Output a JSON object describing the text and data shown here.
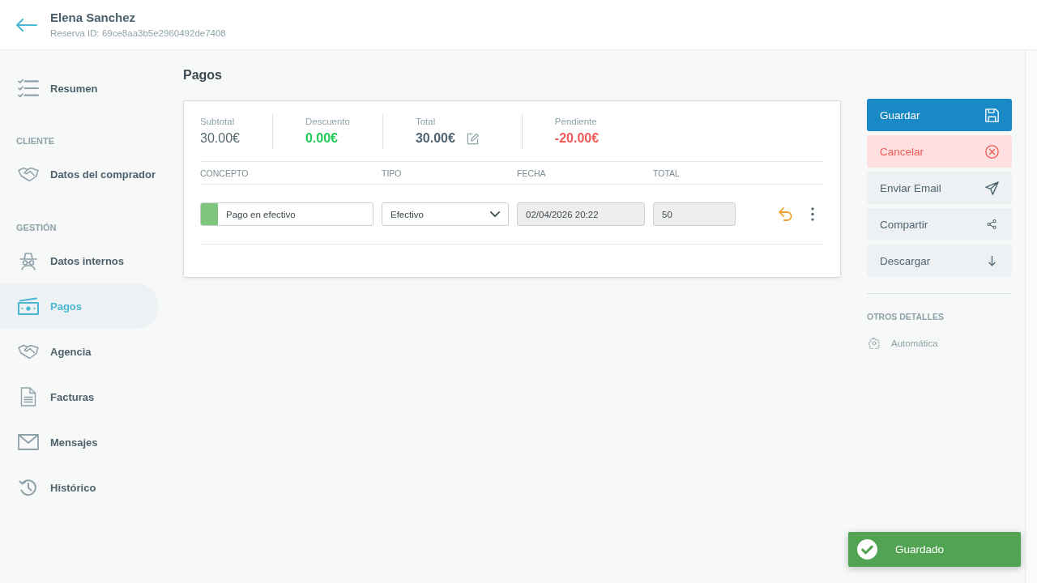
{
  "header": {
    "title": "Elena Sanchez",
    "subtitle": "Reserva ID: 69ce8aa3b5e2960492de7408"
  },
  "sidebar": {
    "groups": [
      {
        "items": [
          {
            "label": "Resumen",
            "selected": false
          }
        ]
      },
      {
        "heading": "CLIENTE",
        "items": [
          {
            "label": "Datos del comprador",
            "selected": false
          }
        ]
      },
      {
        "heading": "GESTIÓN",
        "items": [
          {
            "label": "Datos internos",
            "selected": false
          },
          {
            "label": "Pagos",
            "selected": true
          },
          {
            "label": "Agencia",
            "selected": false
          },
          {
            "label": "Facturas",
            "selected": false
          },
          {
            "label": "Mensajes",
            "selected": false
          },
          {
            "label": "Histórico",
            "selected": false
          }
        ]
      }
    ]
  },
  "page_title": "Pagos",
  "summary": [
    {
      "label": "Subtotal",
      "value": "30.00€",
      "kind": "plain",
      "editable": false
    },
    {
      "label": "Descuento",
      "value": "0.00€",
      "kind": "positive",
      "editable": false
    },
    {
      "label": "Total",
      "value": "30.00€",
      "kind": "emphasis",
      "editable": true
    },
    {
      "label": "Pendiente",
      "value": "-20.00€",
      "kind": "negative",
      "editable": false
    }
  ],
  "table": {
    "columns": [
      "CONCEPTO",
      "TIPO",
      "FECHA",
      "TOTAL"
    ],
    "rows": [
      {
        "color": "#7ec67e",
        "cells": [
          {
            "kind": "text",
            "value": "Pago en efectivo",
            "disabled": false
          },
          {
            "kind": "select",
            "value": "Efectivo",
            "disabled": false
          },
          {
            "kind": "text",
            "value": "02/04/2026 20:22",
            "disabled": true
          },
          {
            "kind": "text",
            "value": "50",
            "disabled": true
          }
        ]
      }
    ]
  },
  "actions": [
    {
      "label": "Guardar",
      "kind": "primary"
    },
    {
      "label": "Cancelar",
      "kind": "danger"
    },
    {
      "label": "Enviar Email",
      "kind": "default"
    },
    {
      "label": "Compartir",
      "kind": "default"
    },
    {
      "label": "Descargar",
      "kind": "default"
    }
  ],
  "other_details": {
    "heading": "OTROS DETALLES",
    "items": [
      {
        "label": "Automática"
      }
    ]
  },
  "toast": {
    "message": "Guardado"
  }
}
